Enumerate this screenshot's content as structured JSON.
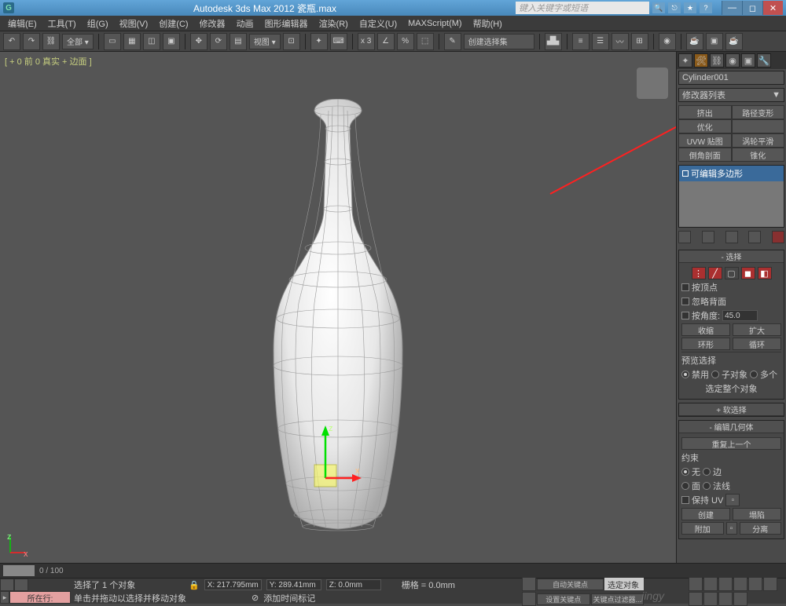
{
  "title_bar": {
    "title": "Autodesk 3ds Max  2012         瓷瓶.max",
    "search_placeholder": "键入关键字或短语"
  },
  "menu": [
    "编辑(E)",
    "工具(T)",
    "组(G)",
    "视图(V)",
    "创建(C)",
    "修改器",
    "动画",
    "图形编辑器",
    "渲染(R)",
    "自定义(U)",
    "MAXScript(M)",
    "帮助(H)"
  ],
  "toolbar": {
    "all_drop": "全部  ▾",
    "view_drop": "视图  ▾",
    "sel_drop": "创建选择集",
    "x_label": "x 3"
  },
  "viewport": {
    "label": "[ + 0 前 0 真实 + 边面 ]"
  },
  "panel": {
    "obj_name": "Cylinder001",
    "modifier_list": "修改器列表",
    "arrow": "▼",
    "mod_btns": [
      {
        "label": "挤出"
      },
      {
        "label": "路径变形"
      },
      {
        "label": "优化"
      },
      {
        "label": ""
      },
      {
        "label": "UVW 贴图"
      },
      {
        "label": "涡轮平滑"
      },
      {
        "label": "倒角剖面"
      },
      {
        "label": "锥化"
      }
    ],
    "stack_item": "可编辑多边形",
    "sel_header": "-         选择",
    "by_vertex": "按顶点",
    "ignore_backfaces": "忽略背面",
    "by_angle": "按角度:",
    "angle_val": "45.0",
    "shrink": "收缩",
    "grow": "扩大",
    "ring": "环形",
    "loop": "循环",
    "preview_sel": "预览选择",
    "disable": "禁用",
    "sub_obj": "子对象",
    "multi": "多个",
    "sel_whole": "选定整个对象",
    "soft_sel": "+         软选择",
    "edit_geom": "-       编辑几何体",
    "repeat_last": "重复上一个",
    "constraint": "约束",
    "c_none": "无",
    "c_edge": "边",
    "c_face": "面",
    "c_normal": "法线",
    "preserve_uv": "保持 UV",
    "settings": "",
    "create": "创建",
    "collapse": "塌陷",
    "attach": "附加",
    "detach": "分离"
  },
  "timeline": {
    "range": "0 / 100"
  },
  "status": {
    "now_button": "所在行:",
    "sel_info": "选择了 1 个对象",
    "hint": "单击并拖动以选择并移动对象",
    "add_time_tag": "添加时间标记",
    "lock_icon": "🔒",
    "x": "X: 217.795mm",
    "y": "Y: 289.41mm",
    "z": "Z: 0.0mm",
    "grid": "栅格 = 0.0mm",
    "auto_key": "自动关键点",
    "selected": "选定对象",
    "set_key": "设置关键点",
    "key_filter": "关键点过滤器..."
  },
  "watermark": "jingy"
}
